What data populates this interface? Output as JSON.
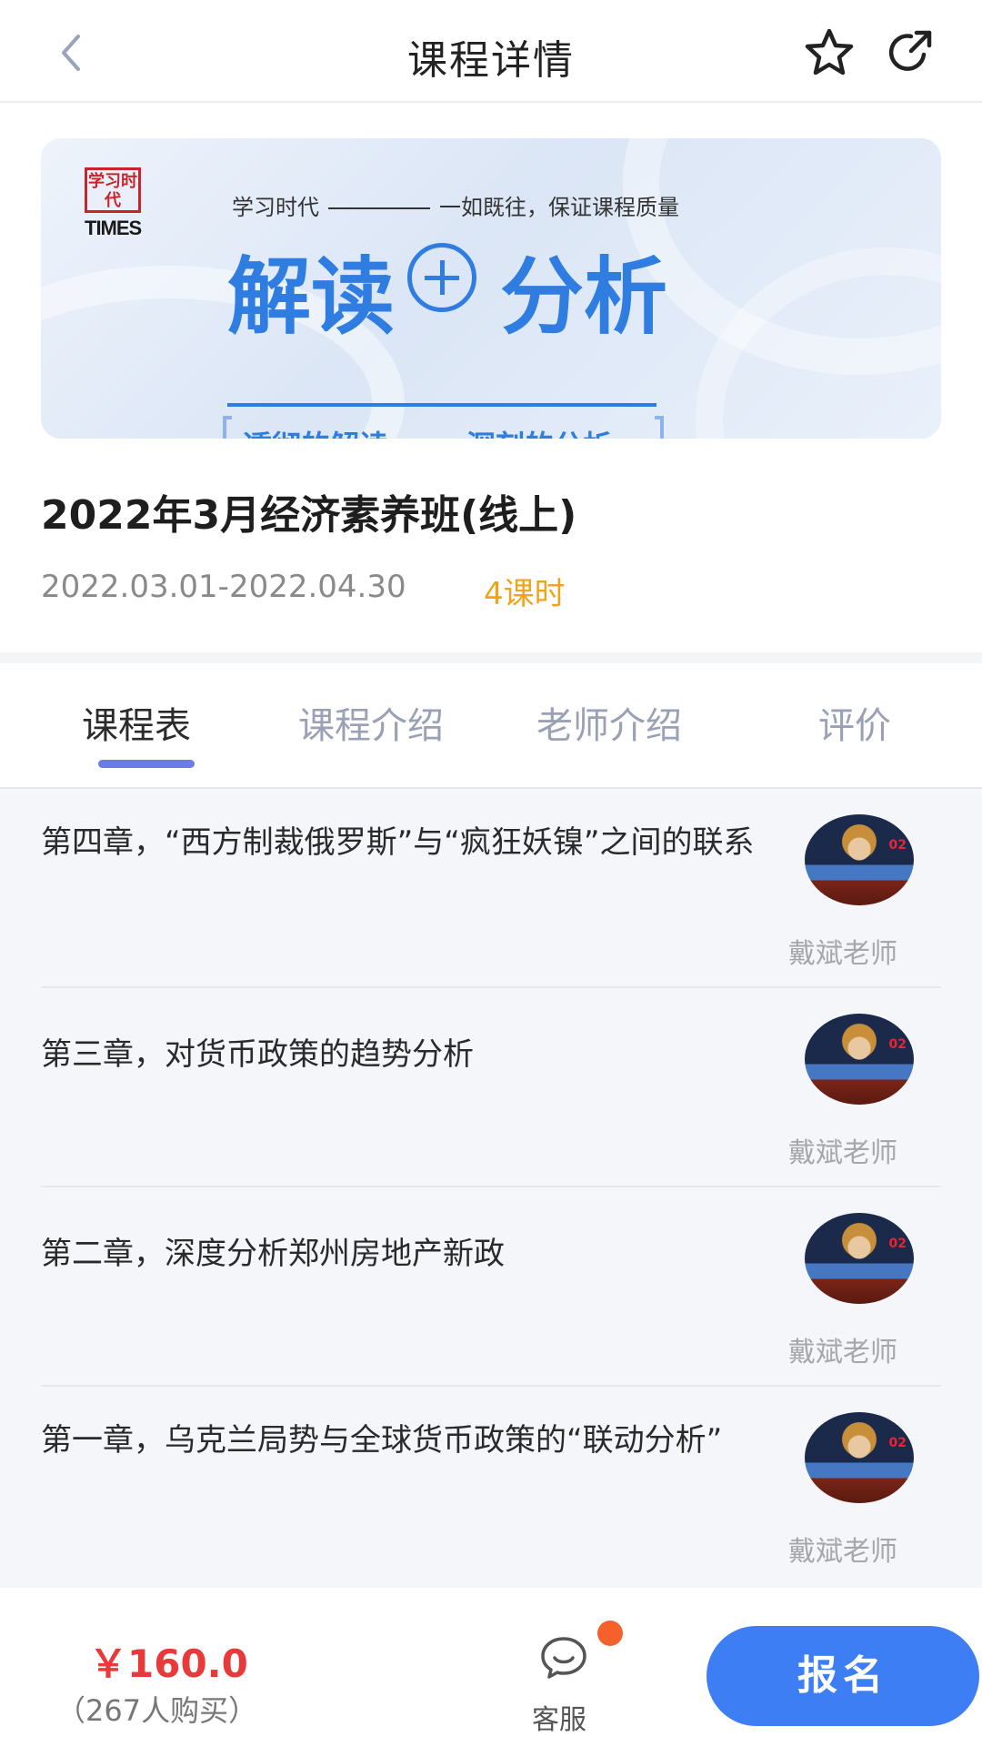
{
  "header": {
    "title": "课程详情",
    "back_icon": "chevron-left-icon",
    "favorite_icon": "star-outline-icon",
    "share_icon": "share-icon"
  },
  "banner": {
    "logo_seal": "学习时代",
    "logo_text": "TIMES",
    "tagline_left": "学习时代",
    "tagline_right": "一如既往，保证课程质量",
    "headline_left": "解读",
    "headline_right": "分析",
    "sub_left": "透彻的解读",
    "sub_right": "深刻的分析",
    "accent_color": "#2f7de1"
  },
  "course": {
    "title": "2022年3月经济素养班(线上)",
    "date_range": "2022.03.01-2022.04.30",
    "hours": "4课时"
  },
  "tabs": [
    {
      "label": "课程表",
      "active": true
    },
    {
      "label": "课程介绍",
      "active": false
    },
    {
      "label": "老师介绍",
      "active": false
    },
    {
      "label": "评价",
      "active": false
    }
  ],
  "lessons": [
    {
      "title": "第四章，“西方制裁俄罗斯”与“疯狂妖镍”之间的联系",
      "teacher": "戴斌老师"
    },
    {
      "title": "第三章，对货币政策的趋势分析",
      "teacher": "戴斌老师"
    },
    {
      "title": "第二章，深度分析郑州房地产新政",
      "teacher": "戴斌老师"
    },
    {
      "title": "第一章，乌克兰局势与全球货币政策的“联动分析”",
      "teacher": "戴斌老师"
    }
  ],
  "bottom": {
    "price": "￥160.0",
    "buyers": "（267人购买）",
    "customer_service": "客服",
    "signup_label": "报名",
    "price_color": "#e83a3a",
    "button_color": "#3d7ef4"
  }
}
